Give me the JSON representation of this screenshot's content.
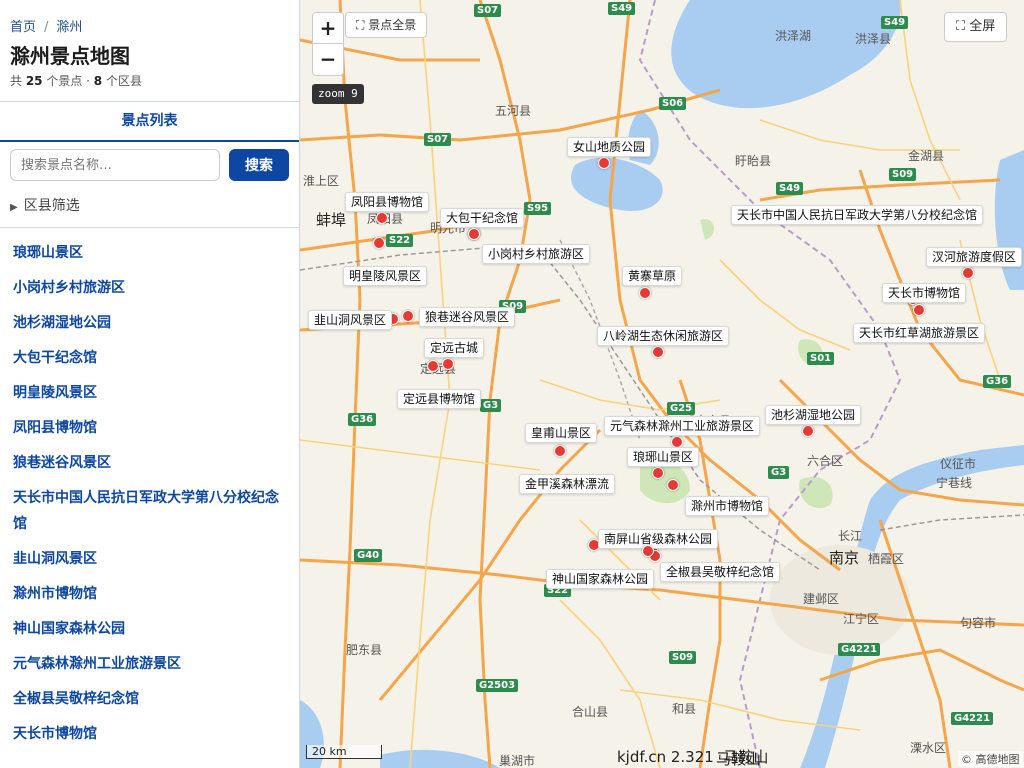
{
  "breadcrumb": {
    "home": "首页",
    "separator": "/",
    "current": "滁州"
  },
  "page_title": "滁州景点地图",
  "stats": {
    "prefix": "共 ",
    "spot_count": "25",
    "spot_unit": " 个景点 · ",
    "district_count": "8",
    "district_unit": " 个区县"
  },
  "tabs": {
    "list_tab": "景点列表"
  },
  "search": {
    "placeholder": "搜索景点名称…",
    "button": "搜索"
  },
  "filter": {
    "toggle_icon": "triangle-right-icon",
    "label": "区县筛选"
  },
  "spot_list": [
    "琅琊山景区",
    "小岗村乡村旅游区",
    "池杉湖湿地公园",
    "大包干纪念馆",
    "明皇陵风景区",
    "凤阳县博物馆",
    "狼巷迷谷风景区",
    "天长市中国人民抗日军政大学第八分校纪念馆",
    "韭山洞风景区",
    "滁州市博物馆",
    "神山国家森林公园",
    "元气森林滁州工业旅游景区",
    "全椒县吴敬梓纪念馆",
    "天长市博物馆"
  ],
  "map": {
    "controls": {
      "zoom_in": "+",
      "zoom_out": "−",
      "overview_icon": "expand-icon",
      "overview": "景点全景",
      "fullscreen_icon": "expand-icon",
      "fullscreen": "全屏",
      "zoom_level": "zoom 9"
    },
    "markers": [
      {
        "name": "女山地质公园"
      },
      {
        "name": "凤阳县博物馆"
      },
      {
        "name": "大包干纪念馆"
      },
      {
        "name": "小岗村乡村旅游区"
      },
      {
        "name": "明皇陵风景区"
      },
      {
        "name": "黄寨草原"
      },
      {
        "name": "天长市中国人民抗日军政大学第八分校纪念馆"
      },
      {
        "name": "汊河旅游度假区"
      },
      {
        "name": "天长市博物馆"
      },
      {
        "name": "韭山洞风景区"
      },
      {
        "name": "狼巷迷谷风景区"
      },
      {
        "name": "天长市红草湖旅游景区"
      },
      {
        "name": "八岭湖生态休闲旅游区"
      },
      {
        "name": "定远古城"
      },
      {
        "name": "定远县博物馆"
      },
      {
        "name": "元气森林滁州工业旅游景区"
      },
      {
        "name": "池杉湖湿地公园"
      },
      {
        "name": "皇甫山景区"
      },
      {
        "name": "琅琊山景区"
      },
      {
        "name": "金甲溪森林漂流"
      },
      {
        "name": "滁州市博物馆"
      },
      {
        "name": "南屏山省级森林公园"
      },
      {
        "name": "全椒县吴敬梓纪念馆"
      },
      {
        "name": "神山国家森林公园"
      }
    ],
    "places": [
      "洪泽湖",
      "洪泽县",
      "五河县",
      "盱眙县",
      "金湖县",
      "淮上区",
      "蚌埠",
      "凤阳县",
      "明光市",
      "定远县",
      "来安县",
      "六合区",
      "仪征市",
      "宁巷线",
      "长江",
      "南京",
      "栖霞区",
      "建邺区",
      "江宁区",
      "句容市",
      "肥东县",
      "合山县",
      "和县",
      "溧水区",
      "巢湖市",
      "马鞍山"
    ],
    "highways": [
      "S07",
      "S49",
      "S49",
      "S06",
      "S07",
      "S95",
      "S22",
      "S49",
      "S09",
      "S09",
      "G3",
      "G36",
      "G25",
      "S01",
      "G36",
      "G3",
      "G40",
      "S22",
      "S09",
      "G2503",
      "G4221",
      "G4221"
    ],
    "scale": "20 km",
    "footer": "kjdf.cn 2.321",
    "footer_place": "马鞍山",
    "attribution": "© 高德地图"
  },
  "colors": {
    "accent": "#0d47a1",
    "marker": "#e53935",
    "water": "#a9cdf0",
    "road_major": "#f5a54a",
    "highway_shield": "#2e8b4e"
  }
}
